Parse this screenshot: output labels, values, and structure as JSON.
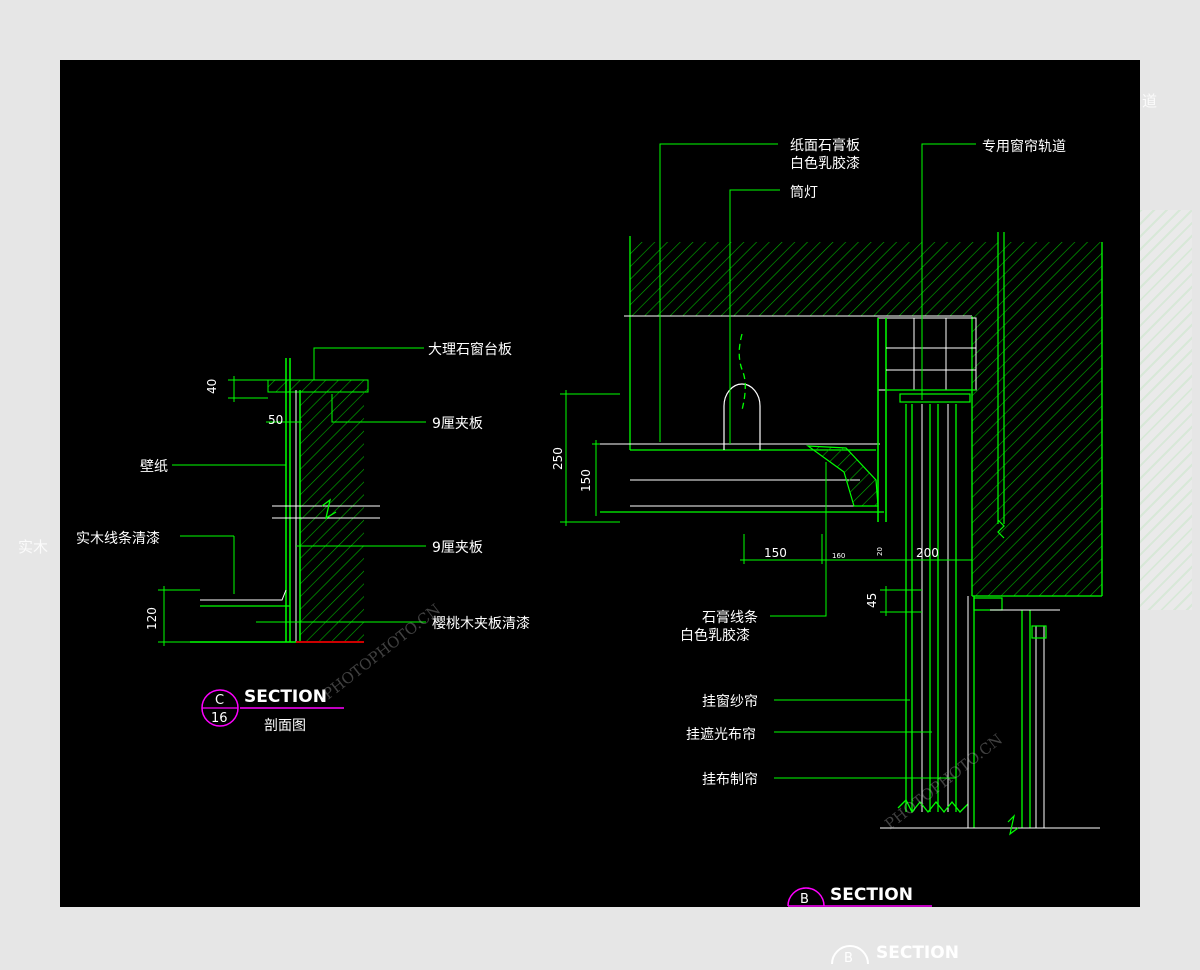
{
  "background_labels": {
    "left_fragment": "实木",
    "right_fragment": "道",
    "bottom_section": {
      "letter": "B",
      "title": "SECTION"
    }
  },
  "left_section": {
    "labels": {
      "marble_sill": "大理石窗台板",
      "plywood_9_top": "9厘夹板",
      "wallpaper": "壁纸",
      "wood_trim": "实木线条清漆",
      "plywood_9_mid": "9厘夹板",
      "cherry_plywood": "樱桃木夹板清漆"
    },
    "dims": {
      "d40": "40",
      "d50": "50",
      "d120": "120"
    },
    "marker": {
      "letter": "C",
      "sheet": "16",
      "title": "SECTION",
      "subtitle": "剖面图"
    }
  },
  "right_section": {
    "labels": {
      "gypsum_line1": "纸面石膏板",
      "gypsum_line2": "白色乳胶漆",
      "downlight": "筒灯",
      "curtain_track": "专用窗帘轨道",
      "plaster_line1": "石膏线条",
      "plaster_line2": "白色乳胶漆",
      "sheer_curtain": "挂窗纱帘",
      "blackout_curtain": "挂遮光布帘",
      "fabric_curtain": "挂布制帘"
    },
    "dims": {
      "d250": "250",
      "d150v": "150",
      "d150h": "150",
      "d160": "160",
      "d20": "20",
      "d200": "200",
      "d45": "45"
    },
    "marker": {
      "letter": "B",
      "title": "SECTION"
    }
  },
  "watermark": {
    "text": "PHOTOPHOTO.CN"
  },
  "colors": {
    "line": "#00ff00",
    "hatch": "#00b400",
    "text": "#ffffff",
    "marker": "#ff00ff",
    "background": "#000000"
  }
}
